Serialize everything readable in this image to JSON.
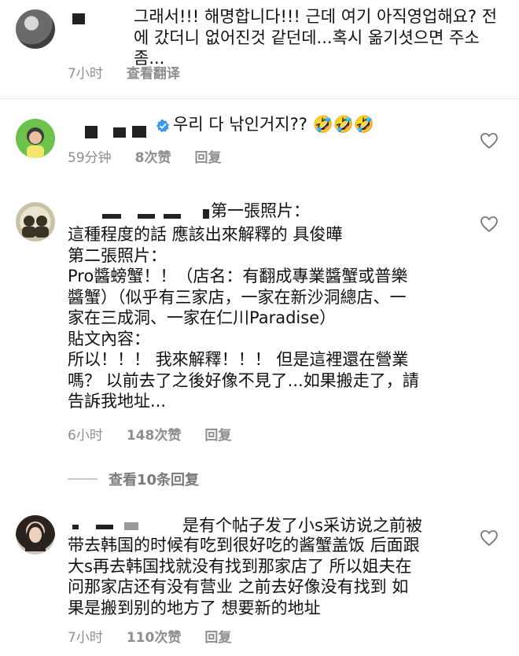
{
  "comments": [
    {
      "text": "그래서!!! 해명합니다!!! 근데 여기 아직영업해요? 전\n에 갔더니 없어진것 같던데...혹시 옮기셧으면 주소좀...",
      "time": "7小时",
      "action": "查看翻译"
    },
    {
      "text": "우리 다 낚인거지?? 🤣🤣🤣",
      "time": "59分钟",
      "likes": "8次赞",
      "reply": "回复"
    },
    {
      "text_first_line": "第一張照片：",
      "text": "這種程度的話 應該出來解釋的 具俊曄\n第二張照片：\nPro醬螃蟹！！（店名：有翻成專業醬蟹或普樂\n醬蟹）（似乎有三家店，一家在新沙洞總店、一\n家在三成洞、一家在仁川Paradise）\n貼文內容：\n所以！！！ 我來解釋！！！ 但是這裡還在營業\n嗎？ 以前去了之後好像不見了...如果搬走了，請\n告訴我地址...",
      "time": "6小时",
      "likes": "148次赞",
      "reply": "回复"
    },
    {
      "text_first_line": "是有个帖子发了小s采访说之前被",
      "text": "带去韩国的时候有吃到很好吃的酱蟹盖饭 后面跟\n大s再去韩国找就没有找到那家店了 所以姐夫在\n问那家店还有没有营业 之前去好像没有找到 如\n果是搬到别的地方了 想要新的地址",
      "time": "7小时",
      "likes": "110次赞",
      "reply": "回复"
    }
  ],
  "view_more": "查看10条回复",
  "colors": {
    "meta": "#8e8e8e",
    "verified": "#3897f0"
  }
}
